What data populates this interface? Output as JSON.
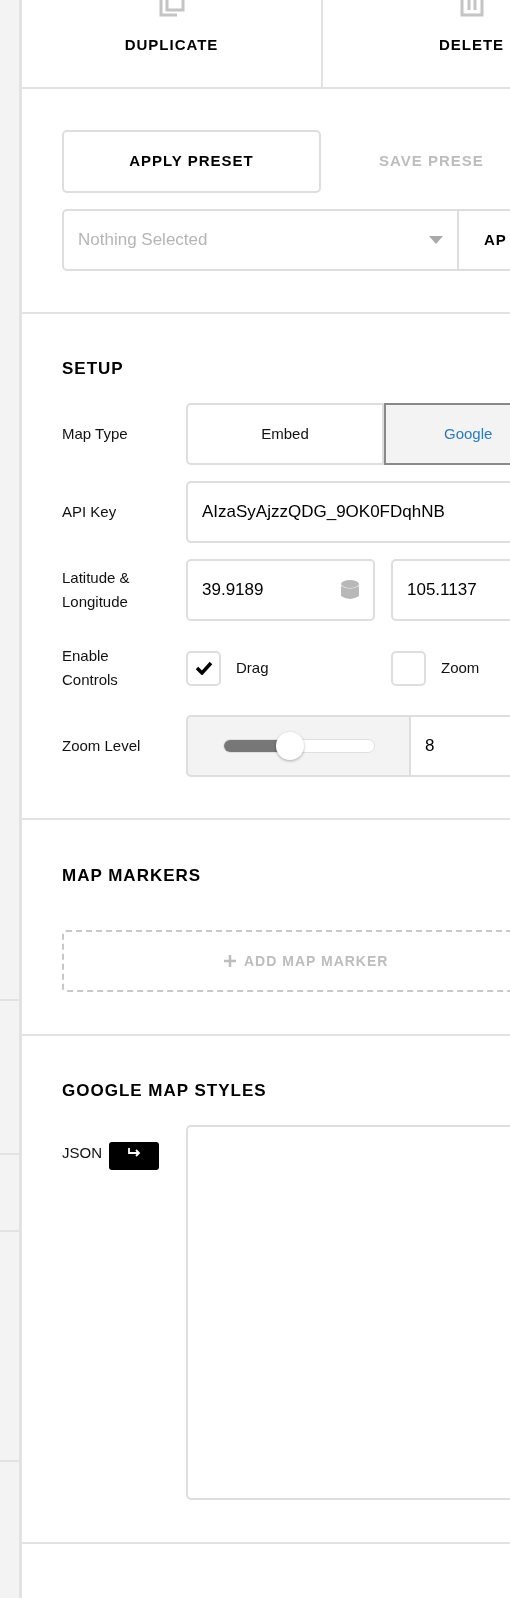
{
  "actions": [
    {
      "label": "DUPLICATE",
      "kind": "duplicate"
    },
    {
      "label": "DELETE",
      "kind": "delete"
    }
  ],
  "presets": {
    "apply_button": "APPLY PRESET",
    "save_button": "SAVE PRESE",
    "save_disabled": true,
    "select": {
      "placeholder": "Nothing Selected"
    },
    "select_button": "AP"
  },
  "setup": {
    "title": "SETUP",
    "map_type": {
      "label": "Map Type",
      "options": [
        {
          "label": "Embed",
          "selected": false
        },
        {
          "label": "Google",
          "selected": true
        }
      ]
    },
    "api_key": {
      "label": "API Key",
      "value": "AIzaSyAjzzQDG_9OK0FDqhNB"
    },
    "location": {
      "label": "Latitude & Longitude",
      "latitude": "39.9189",
      "longitude": "105.1137"
    },
    "controls": {
      "label": "Enable Controls",
      "options": [
        {
          "label": "Drag",
          "checked": true
        },
        {
          "label": "Zoom",
          "checked": false
        }
      ]
    },
    "zoom": {
      "label": "Zoom Level",
      "level": 0.44,
      "value": "8"
    }
  },
  "markers": {
    "title": "MAP MARKERS",
    "add_button": "ADD MAP MARKER"
  },
  "styles": {
    "title": "GOOGLE MAP STYLES",
    "json_label": "JSON"
  }
}
